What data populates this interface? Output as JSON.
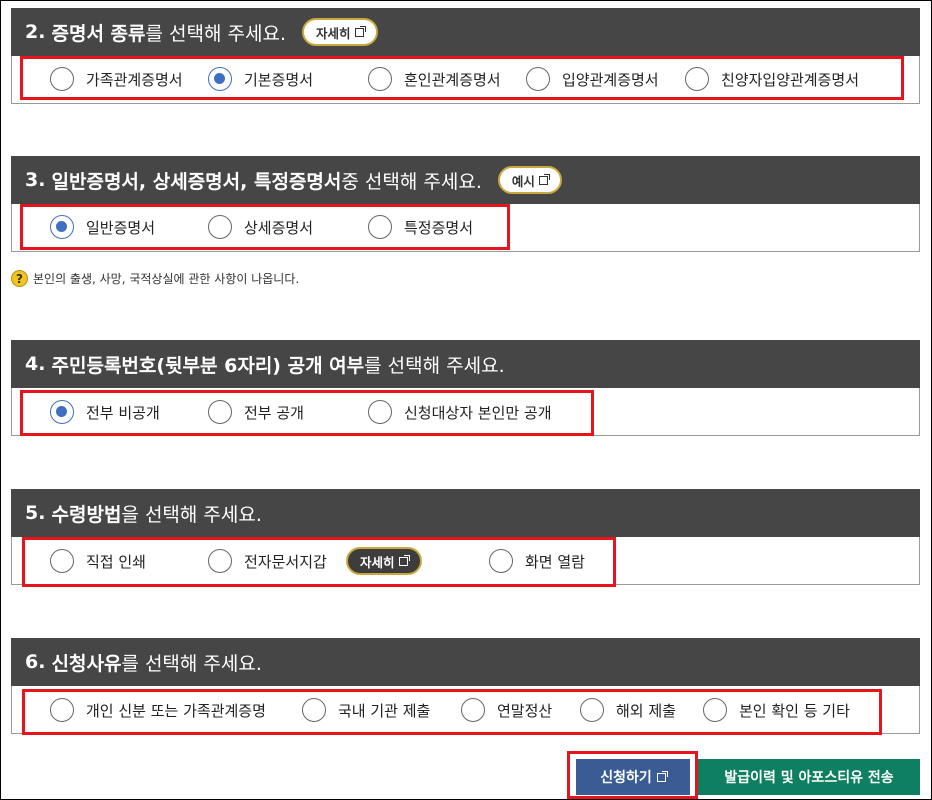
{
  "sections": [
    {
      "num": "2.",
      "bold": "증명서 종류",
      "rest": "를 선택해 주세요.",
      "pill": "자세히",
      "options": [
        {
          "label": "가족관계증명서",
          "checked": false
        },
        {
          "label": "기본증명서",
          "checked": true
        },
        {
          "label": "혼인관계증명서",
          "checked": false
        },
        {
          "label": "입양관계증명서",
          "checked": false
        },
        {
          "label": "친양자입양관계증명서",
          "checked": false
        }
      ]
    },
    {
      "num": "3.",
      "bold": "일반증명서, 상세증명서, 특정증명서",
      "rest": " 중 선택해 주세요.",
      "pill": "예시",
      "options": [
        {
          "label": "일반증명서",
          "checked": true
        },
        {
          "label": "상세증명서",
          "checked": false
        },
        {
          "label": "특정증명서",
          "checked": false
        }
      ],
      "note": "본인의 출생, 사망, 국적상실에 관한 사항이 나옵니다."
    },
    {
      "num": "4.",
      "bold": "주민등록번호(뒷부분 6자리) 공개 여부",
      "rest": "를 선택해 주세요.",
      "options": [
        {
          "label": "전부 비공개",
          "checked": true
        },
        {
          "label": "전부 공개",
          "checked": false
        },
        {
          "label": "신청대상자 본인만 공개",
          "checked": false
        }
      ]
    },
    {
      "num": "5.",
      "bold": "수령방법",
      "rest": "을 선택해 주세요.",
      "options": [
        {
          "label": "직접 인쇄",
          "checked": false
        },
        {
          "label": "전자문서지갑",
          "checked": false
        },
        {
          "label": "화면 열람",
          "checked": false
        }
      ],
      "inline_pill": "자세히"
    },
    {
      "num": "6.",
      "bold": "신청사유",
      "rest": "를 선택해 주세요.",
      "options": [
        {
          "label": "개인 신분 또는 가족관계증명",
          "checked": false
        },
        {
          "label": "국내 기관 제출",
          "checked": false
        },
        {
          "label": "연말정산",
          "checked": false
        },
        {
          "label": "해외 제출",
          "checked": false
        },
        {
          "label": "본인 확인 등 기타",
          "checked": false
        }
      ]
    }
  ],
  "buttons": {
    "apply": "신청하기",
    "history": "발급이력 및 아포스티유 전송"
  },
  "icons": {
    "external_link": "external-link-icon",
    "help": "question-icon"
  },
  "colors": {
    "header_bg": "#464646",
    "highlight": "#e8141c",
    "radio_checked": "#3f6fc1",
    "pill_border": "#c9a93d",
    "apply_bg": "#3a5b93",
    "history_bg": "#0e7f60"
  }
}
